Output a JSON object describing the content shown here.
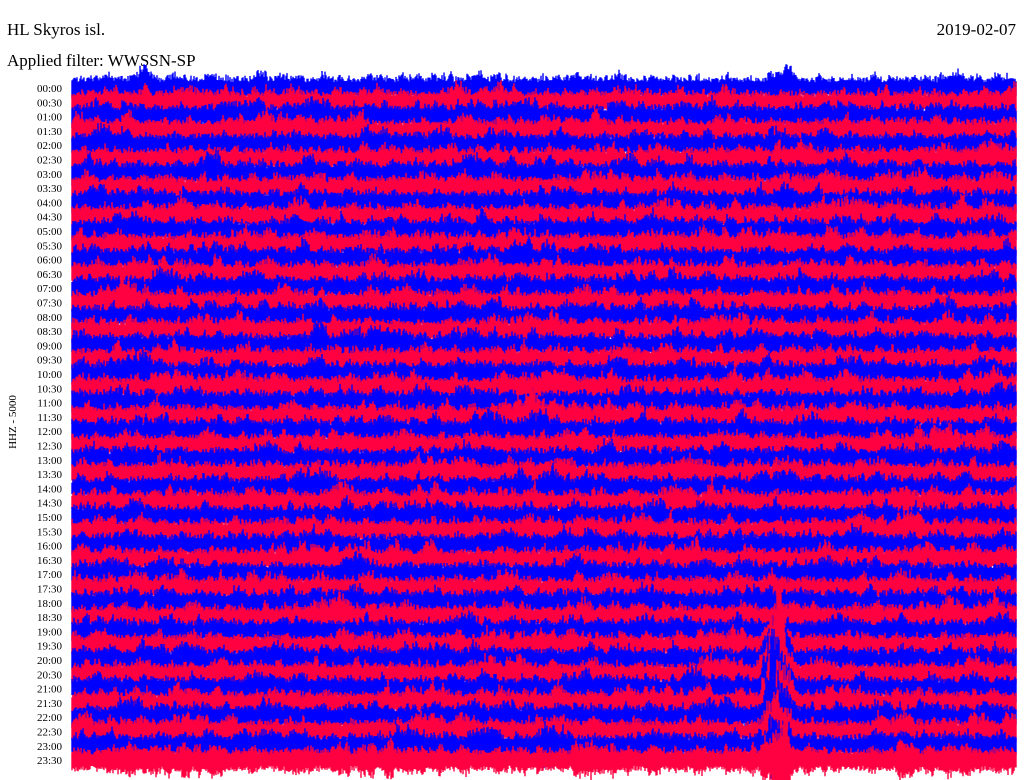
{
  "header": {
    "station": "HL Skyros isl.",
    "date": "2019-02-07",
    "filter": "Applied filter: WWSSN-SP",
    "channel": "HHZ - 5000"
  },
  "colors": {
    "trace_a": "#0000ff",
    "trace_b": "#ff0040",
    "background": "#ffffff",
    "text": "#000000"
  },
  "chart_data": {
    "type": "helicorder",
    "title": "",
    "xlabel": "",
    "ylabel": "HHZ - 5000",
    "grid": false,
    "legend": "none",
    "row_interval_minutes": 30,
    "row_colors": [
      "#0000ff",
      "#ff0040"
    ],
    "row_labels": [
      "00:00",
      "00:30",
      "01:00",
      "01:30",
      "02:00",
      "02:30",
      "03:00",
      "03:30",
      "04:00",
      "04:30",
      "05:00",
      "05:30",
      "06:00",
      "06:30",
      "07:00",
      "07:30",
      "08:00",
      "08:30",
      "09:00",
      "09:30",
      "10:00",
      "10:30",
      "11:00",
      "11:30",
      "12:00",
      "12:30",
      "13:00",
      "13:30",
      "14:00",
      "14:30",
      "15:00",
      "15:30",
      "16:00",
      "16:30",
      "17:00",
      "17:30",
      "18:00",
      "18:30",
      "19:00",
      "19:30",
      "20:00",
      "20:30",
      "21:00",
      "21:30",
      "22:00",
      "22:30",
      "23:00",
      "23:30"
    ],
    "events": [
      {
        "row_label": "11:30",
        "minute": 14.6,
        "amplitude": 2.0
      },
      {
        "row_label": "12:00",
        "minute": 14.6,
        "amplitude": 1.6
      },
      {
        "row_label": "19:30",
        "minute": 22.4,
        "amplitude": 1.8
      },
      {
        "row_label": "20:00",
        "minute": 22.4,
        "amplitude": 3.0
      },
      {
        "row_label": "20:30",
        "minute": 22.4,
        "amplitude": 4.5
      },
      {
        "row_label": "21:00",
        "minute": 22.4,
        "amplitude": 5.5
      },
      {
        "row_label": "21:30",
        "minute": 22.4,
        "amplitude": 5.0
      },
      {
        "row_label": "22:00",
        "minute": 22.4,
        "amplitude": 4.0
      },
      {
        "row_label": "22:30",
        "minute": 22.4,
        "amplitude": 3.0
      },
      {
        "row_label": "23:00",
        "minute": 22.4,
        "amplitude": 2.5
      },
      {
        "row_label": "23:30",
        "minute": 22.4,
        "amplitude": 3.0
      }
    ]
  }
}
